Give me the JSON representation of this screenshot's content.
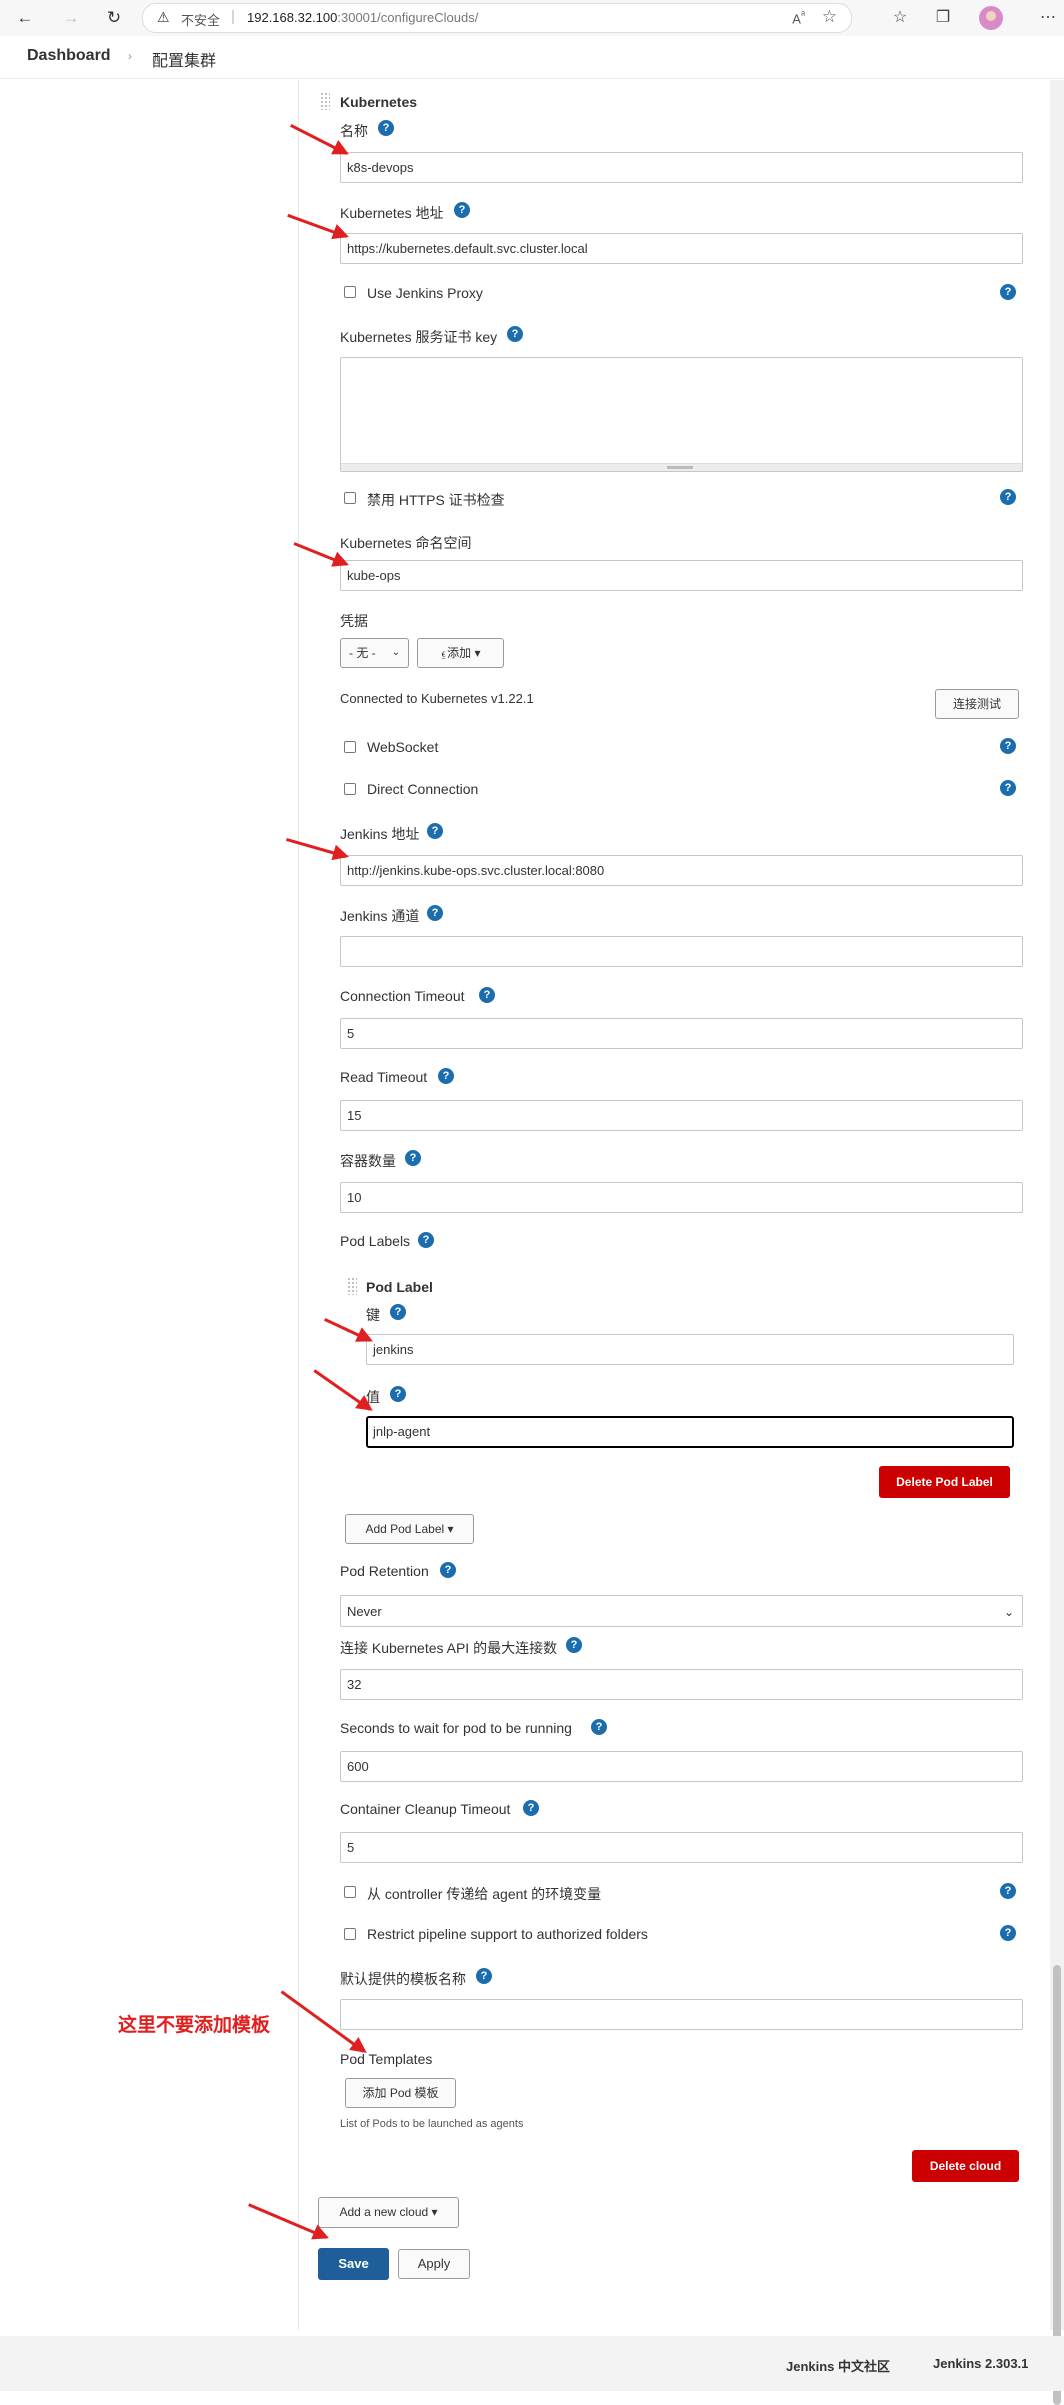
{
  "browser": {
    "back_icon": "arrow-left-icon",
    "forward_icon": "arrow-right-icon",
    "reload_icon": "reload-icon",
    "security_label": "不安全",
    "url_host": "192.168.32.100",
    "url_path": ":30001/configureClouds/",
    "read_aloud": "A",
    "read_aloud_sup": "ᵃ"
  },
  "breadcrumb": {
    "dashboard": "Dashboard",
    "separator": "›",
    "current": "配置集群"
  },
  "form": {
    "section_title": "Kubernetes",
    "name_label": "名称",
    "name_value": "k8s-devops",
    "url_label": "Kubernetes 地址",
    "url_value": "https://kubernetes.default.svc.cluster.local",
    "use_proxy_label": "Use Jenkins Proxy",
    "cert_key_label": "Kubernetes 服务证书 key",
    "disable_https_label": "禁用 HTTPS 证书检查",
    "namespace_label": "Kubernetes 命名空间",
    "namespace_value": "kube-ops",
    "credentials_label": "凭据",
    "credentials_select": "- 无 -",
    "credentials_add": "添加",
    "connection_status": "Connected to Kubernetes v1.22.1",
    "test_connection": "连接测试",
    "websocket_label": "WebSocket",
    "direct_connection_label": "Direct Connection",
    "jenkins_url_label": "Jenkins 地址",
    "jenkins_url_value": "http://jenkins.kube-ops.svc.cluster.local:8080",
    "jenkins_tunnel_label": "Jenkins 通道",
    "jenkins_tunnel_value": "",
    "connection_timeout_label": "Connection Timeout",
    "connection_timeout_value": "5",
    "read_timeout_label": "Read Timeout",
    "read_timeout_value": "15",
    "container_cap_label": "容器数量",
    "container_cap_value": "10",
    "pod_labels_label": "Pod Labels",
    "pod_label_title": "Pod Label",
    "key_label": "键",
    "key_value": "jenkins",
    "value_label": "值",
    "value_value": "jnlp-agent",
    "delete_pod_label": "Delete Pod Label",
    "add_pod_label": "Add Pod Label",
    "pod_retention_label": "Pod Retention",
    "pod_retention_value": "Never",
    "max_connections_label": "连接 Kubernetes API 的最大连接数",
    "max_connections_value": "32",
    "wait_seconds_label": "Seconds to wait for pod to be running",
    "wait_seconds_value": "600",
    "cleanup_timeout_label": "Container Cleanup Timeout",
    "cleanup_timeout_value": "5",
    "pass_env_label": "从 controller 传递给 agent 的环境变量",
    "restrict_pipeline_label": "Restrict pipeline support to authorized folders",
    "default_template_label": "默认提供的模板名称",
    "default_template_value": "",
    "pod_templates_label": "Pod Templates",
    "add_pod_template": "添加 Pod 模板",
    "pod_templates_hint": "List of Pods to be launched as agents",
    "delete_cloud": "Delete cloud",
    "add_new_cloud": "Add a new cloud",
    "save": "Save",
    "apply": "Apply",
    "help_glyph": "?",
    "caret": "▾"
  },
  "annotation": {
    "note_text": "这里不要添加模板",
    "color": "#e02020"
  },
  "footer": {
    "community": "Jenkins 中文社区",
    "version": "Jenkins 2.303.1"
  }
}
